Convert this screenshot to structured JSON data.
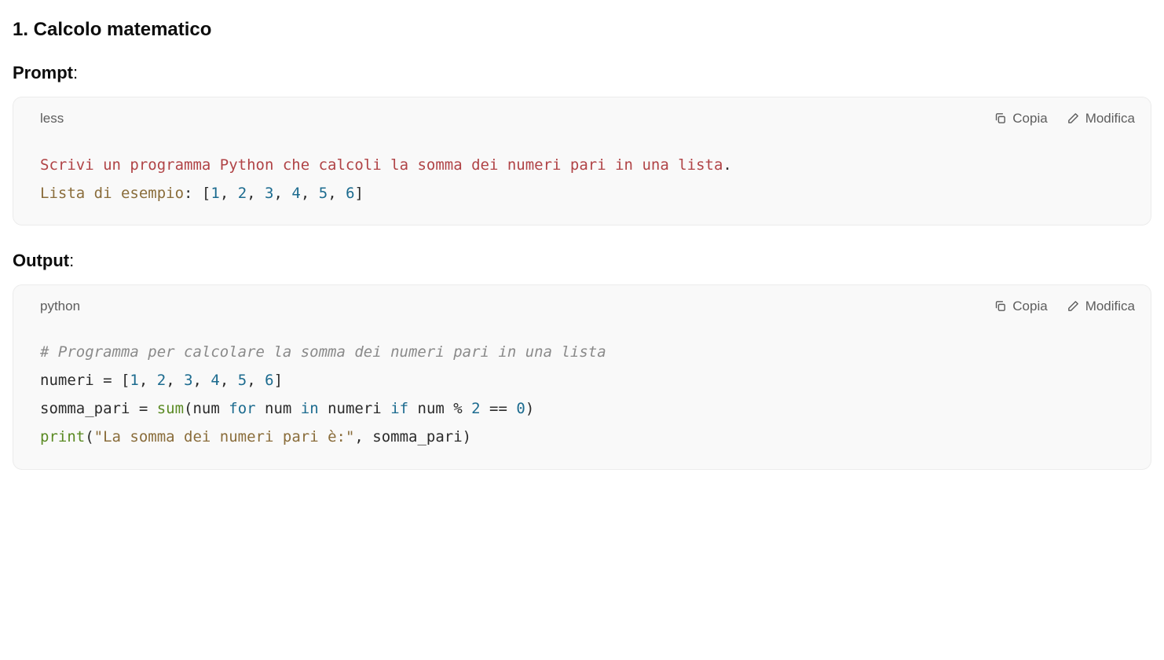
{
  "section": {
    "title": "1. Calcolo matematico"
  },
  "prompt": {
    "label": "Prompt",
    "colon": ":",
    "lang": "less",
    "actions": {
      "copy": "Copia",
      "edit": "Modifica"
    },
    "code": {
      "line1a": "Scrivi",
      "line1b": " un programma Python che calcoli la somma dei numeri pari ",
      "line1c": "in",
      "line1d": " una lista",
      "line1e": ".",
      "line2a": "Lista di esempio",
      "line2b": ": [",
      "line2c": "1",
      "line2d": ", ",
      "line2e": "2",
      "line2f": ", ",
      "line2g": "3",
      "line2h": ", ",
      "line2i": "4",
      "line2j": ", ",
      "line2k": "5",
      "line2l": ", ",
      "line2m": "6",
      "line2n": "]"
    }
  },
  "output": {
    "label": "Output",
    "colon": ":",
    "lang": "python",
    "actions": {
      "copy": "Copia",
      "edit": "Modifica"
    },
    "code": {
      "l1": "# Programma per calcolare la somma dei numeri pari in una lista",
      "l2a": "numeri = [",
      "l2n1": "1",
      "l2c1": ", ",
      "l2n2": "2",
      "l2c2": ", ",
      "l2n3": "3",
      "l2c3": ", ",
      "l2n4": "4",
      "l2c4": ", ",
      "l2n5": "5",
      "l2c5": ", ",
      "l2n6": "6",
      "l2b": "]",
      "l3a": "somma_pari = ",
      "l3sum": "sum",
      "l3b": "(num ",
      "l3for": "for",
      "l3c": " num ",
      "l3in": "in",
      "l3d": " numeri ",
      "l3if": "if",
      "l3e": " num % ",
      "l3two": "2",
      "l3eq": " == ",
      "l3zero": "0",
      "l3f": ")",
      "l4print": "print",
      "l4a": "(",
      "l4str": "\"La somma dei numeri pari è:\"",
      "l4b": ", somma_pari)"
    }
  }
}
